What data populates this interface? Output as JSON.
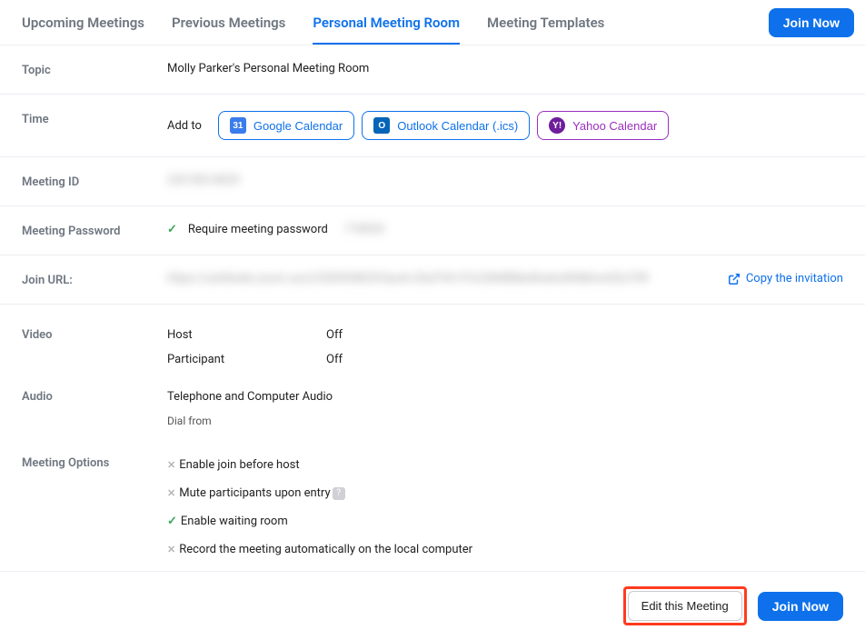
{
  "tabs": {
    "upcoming": "Upcoming Meetings",
    "previous": "Previous Meetings",
    "pmr": "Personal Meeting Room",
    "templates": "Meeting Templates"
  },
  "join_now": "Join Now",
  "topic": {
    "label": "Topic",
    "value": "Molly Parker's Personal Meeting Room"
  },
  "time": {
    "label": "Time",
    "addto": "Add to",
    "google": "Google Calendar",
    "outlook": "Outlook Calendar (.ics)",
    "yahoo": "Yahoo Calendar"
  },
  "meeting_id": {
    "label": "Meeting ID",
    "value": "235 093 8029"
  },
  "password": {
    "label": "Meeting Password",
    "require": "Require meeting password",
    "value": "718920"
  },
  "join_url": {
    "label": "Join URL:",
    "value": "https://us04web.zoom.us/j/2350938029?pwd=ZkxFVk1tTnCiN48NksNnehnNfd8nnn02z709",
    "copy": "Copy the invitation"
  },
  "video": {
    "label": "Video",
    "host": "Host",
    "host_val": "Off",
    "participant": "Participant",
    "participant_val": "Off"
  },
  "audio": {
    "label": "Audio",
    "value": "Telephone and Computer Audio",
    "dial": "Dial from"
  },
  "options": {
    "label": "Meeting Options",
    "join_before": "Enable join before host",
    "mute": "Mute participants upon entry",
    "waiting": "Enable waiting room",
    "record": "Record the meeting automatically on the local computer"
  },
  "bottom": {
    "edit": "Edit this Meeting",
    "join": "Join Now"
  }
}
